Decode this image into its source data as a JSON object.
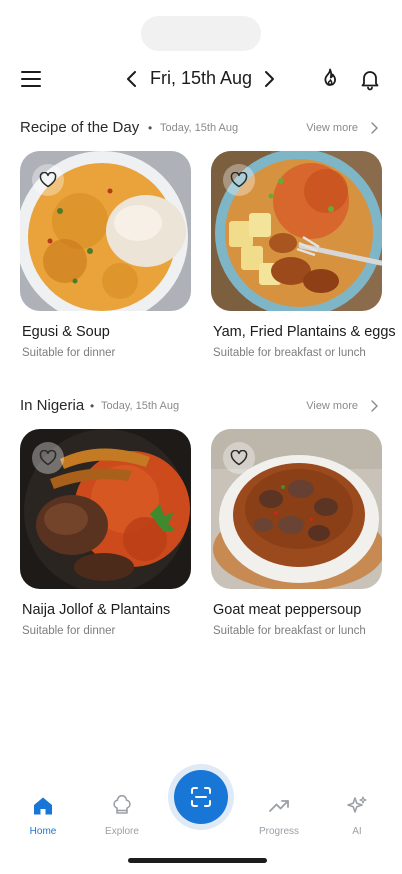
{
  "header": {
    "date": "Fri, 15th Aug"
  },
  "sections": [
    {
      "title": "Recipe of the Day",
      "date": "Today, 15th Aug",
      "view_more": "View more",
      "cards": [
        {
          "title": "Egusi & Soup",
          "subtitle": "Suitable for dinner"
        },
        {
          "title": "Yam, Fried Plantains & eggs",
          "subtitle": "Suitable for breakfast or lunch"
        }
      ]
    },
    {
      "title": "In Nigeria",
      "date": "Today, 15th Aug",
      "view_more": "View more",
      "cards": [
        {
          "title": "Naija Jollof & Plantains",
          "subtitle": "Suitable for dinner"
        },
        {
          "title": "Goat meat peppersoup",
          "subtitle": "Suitable for breakfast or lunch"
        }
      ]
    }
  ],
  "tabbar": {
    "items": [
      {
        "label": "Home",
        "icon": "home-icon",
        "active": true
      },
      {
        "label": "Explore",
        "icon": "chef-hat-icon",
        "active": false
      },
      {
        "label": "Progress",
        "icon": "trending-up-icon",
        "active": false
      },
      {
        "label": "AI",
        "icon": "sparkle-icon",
        "active": false
      }
    ],
    "center_icon": "scan-icon"
  },
  "colors": {
    "accent": "#1877d6",
    "text": "#1c1c1c",
    "muted": "#8a8a8a"
  }
}
